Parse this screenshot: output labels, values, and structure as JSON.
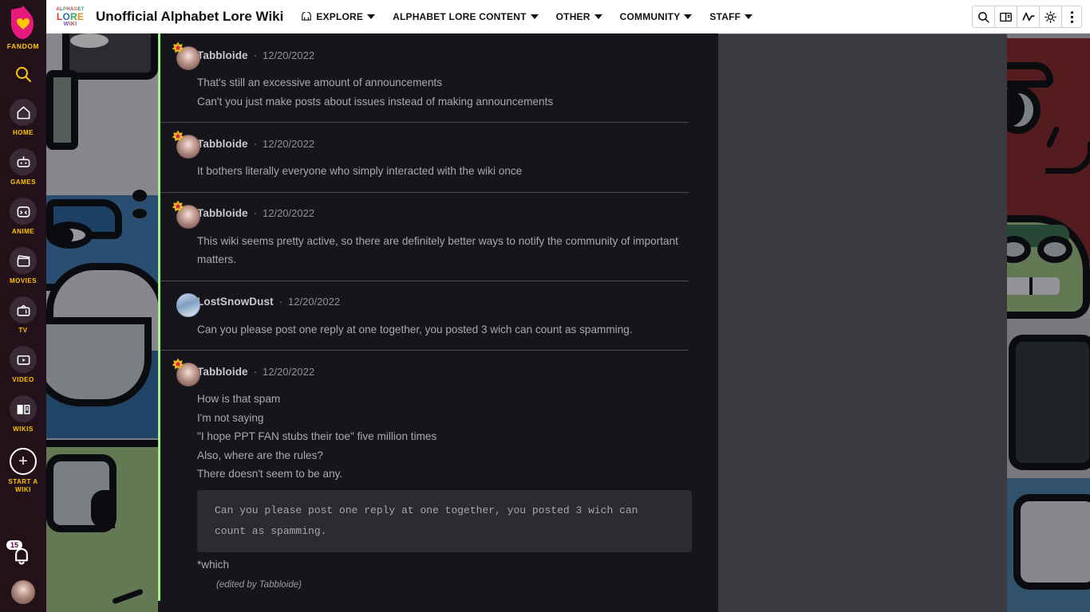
{
  "global_rail": {
    "brand": "FANDOM",
    "search_icon": "search-icon",
    "items": [
      {
        "label": "HOME",
        "icon": "home-icon"
      },
      {
        "label": "GAMES",
        "icon": "game-controller-icon"
      },
      {
        "label": "ANIME",
        "icon": "anime-face-icon"
      },
      {
        "label": "MOVIES",
        "icon": "clapperboard-icon"
      },
      {
        "label": "TV",
        "icon": "television-icon"
      },
      {
        "label": "VIDEO",
        "icon": "play-button-icon"
      },
      {
        "label": "WIKIS",
        "icon": "open-book-icon"
      }
    ],
    "start_wiki_label": "START A WIKI",
    "notification_count": "15"
  },
  "wiki_header": {
    "logo": {
      "line1": "ALPHABET",
      "line2": "LORE",
      "line3": "WIKI"
    },
    "title": "Unofficial Alphabet Lore Wiki",
    "nav": [
      {
        "label": "EXPLORE",
        "has_caret": true,
        "icon": "explore-icon"
      },
      {
        "label": "ALPHABET LORE CONTENT",
        "has_caret": true
      },
      {
        "label": "OTHER",
        "has_caret": true
      },
      {
        "label": "COMMUNITY",
        "has_caret": true
      },
      {
        "label": "STAFF",
        "has_caret": true
      }
    ],
    "tools": [
      {
        "name": "search-icon"
      },
      {
        "name": "book-icon"
      },
      {
        "name": "activity-pulse-icon"
      },
      {
        "name": "theme-sun-icon"
      },
      {
        "name": "kebab-menu-icon"
      }
    ]
  },
  "accent_colors": {
    "comment_border": "#a2f08a",
    "fandom_yellow": "#ffc500",
    "fandom_rail": "#231119",
    "content_bg": "#16161a",
    "right_pane_bg": "#3a3a40"
  },
  "discussion": {
    "comments": [
      {
        "author": "Tabbloide",
        "separator": "·",
        "date": "12/20/2022",
        "avatar": "tabbloide-avatar",
        "has_badge": true,
        "lines": [
          "That's still an excessive amount of announcements",
          "Can't you just make posts about issues instead of making announcements"
        ]
      },
      {
        "author": "Tabbloide",
        "separator": "·",
        "date": "12/20/2022",
        "avatar": "tabbloide-avatar",
        "has_badge": true,
        "lines": [
          "It bothers literally everyone who simply interacted with the wiki once"
        ]
      },
      {
        "author": "Tabbloide",
        "separator": "·",
        "date": "12/20/2022",
        "avatar": "tabbloide-avatar",
        "has_badge": true,
        "lines": [
          "This wiki seems pretty active, so there are definitely better ways to notify the community of important matters."
        ]
      },
      {
        "author": "LostSnowDust",
        "separator": "·",
        "date": "12/20/2022",
        "avatar": "lostsnowdust-avatar",
        "has_badge": false,
        "lines": [
          "Can you please post one reply at one together, you posted 3 wich can count as spamming."
        ]
      },
      {
        "author": "Tabbloide",
        "separator": "·",
        "date": "12/20/2022",
        "avatar": "tabbloide-avatar",
        "has_badge": true,
        "lines": [
          "How is that spam",
          "I'm not saying",
          "\"I hope PPT FAN stubs their toe\" five million times",
          "Also, where are the rules?",
          "There doesn't seem to be any."
        ],
        "quote": "Can you please post one reply at one together, you posted 3 wich can count as spamming.",
        "after_quote_lines": [
          "*which"
        ],
        "edited_note": "(edited by Tabbloide)"
      }
    ]
  }
}
